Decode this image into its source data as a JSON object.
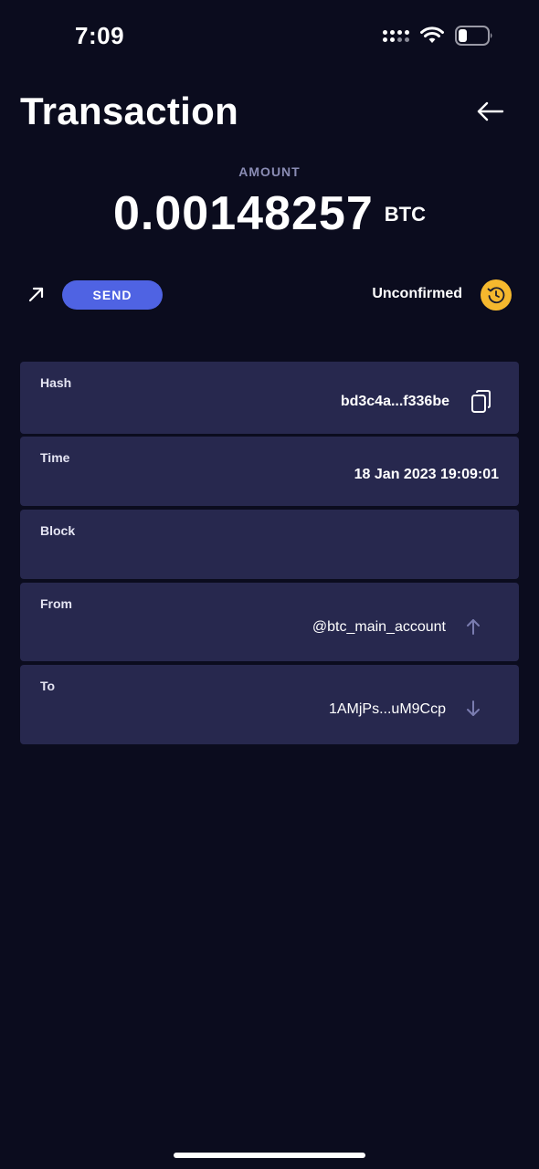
{
  "status_bar": {
    "time": "7:09",
    "icons": [
      "cellular-signal-icon",
      "wifi-icon",
      "battery-icon"
    ]
  },
  "header": {
    "title": "Transaction",
    "back_icon": "back-arrow-icon"
  },
  "amount": {
    "label": "AMOUNT",
    "value": "0.00148257",
    "unit": "BTC"
  },
  "transaction_type": {
    "icon": "outgoing-arrow-icon",
    "label": "SEND"
  },
  "transaction_status": {
    "label": "Unconfirmed",
    "icon": "pending-clock-icon"
  },
  "details": {
    "hash": {
      "label": "Hash",
      "value": "bd3c4a...f336be",
      "icon": "copy-icon"
    },
    "time": {
      "label": "Time",
      "value": "18 Jan 2023 19:09:01"
    },
    "block": {
      "label": "Block",
      "value": ""
    },
    "from": {
      "label": "From",
      "value": "@btc_main_account",
      "icon": "arrow-up-icon"
    },
    "to": {
      "label": "To",
      "value": "1AMjPs...uM9Ccp",
      "icon": "arrow-down-icon"
    }
  },
  "colors": {
    "background": "#0b0c1e",
    "card": "#27284e",
    "accent": "#4f63e3",
    "pending": "#f5b82e",
    "muted": "#8a8cb4"
  }
}
